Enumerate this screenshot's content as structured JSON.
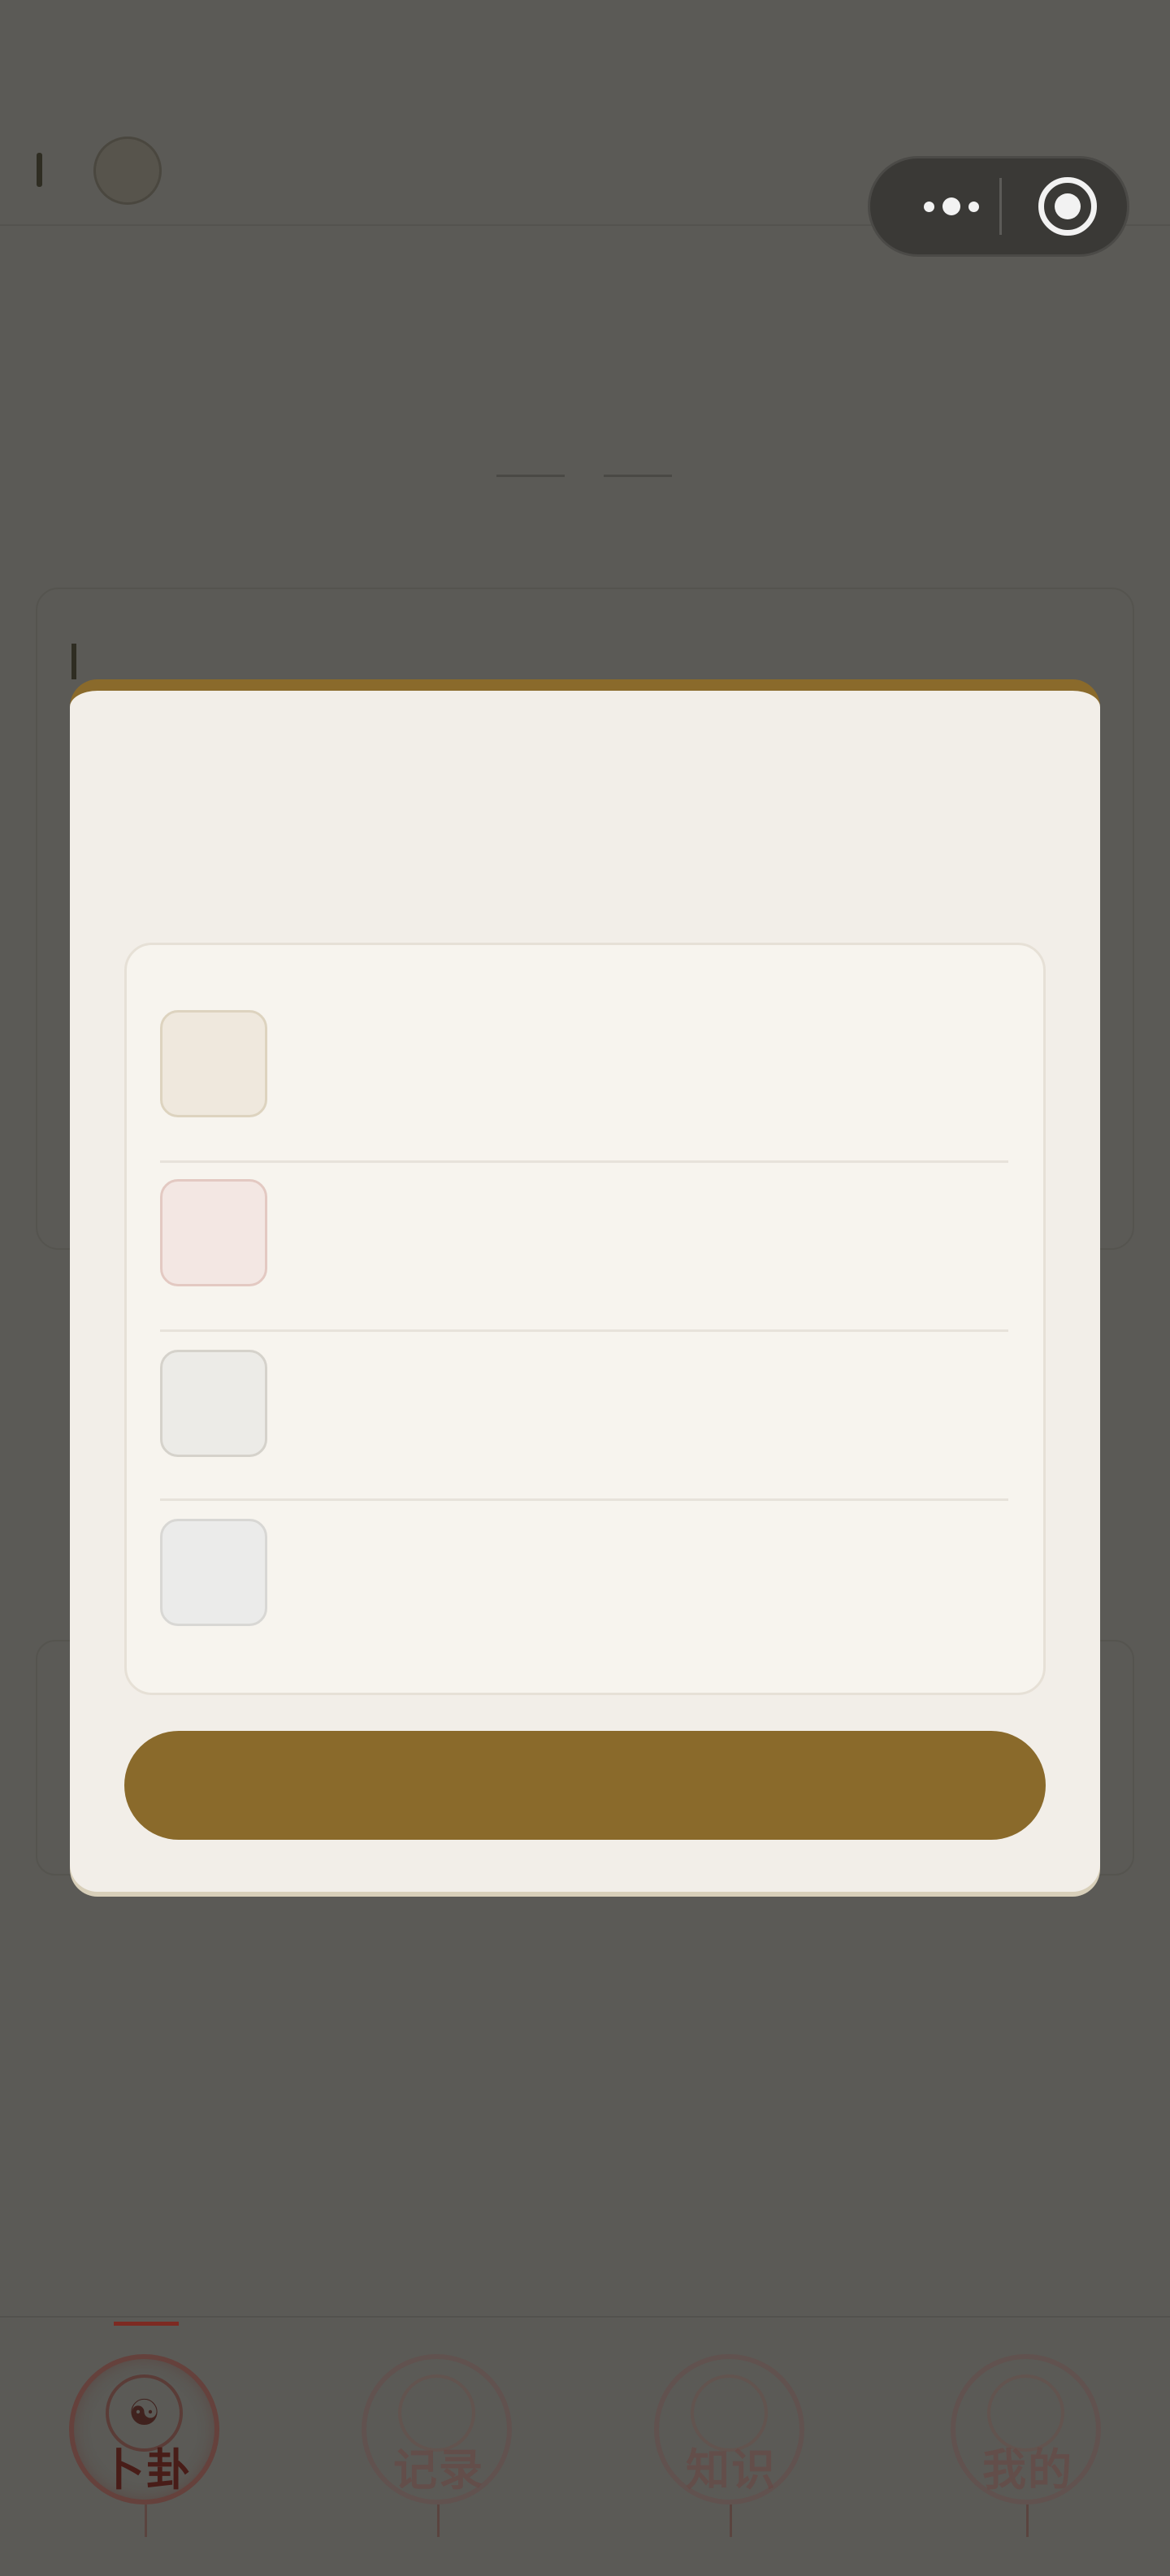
{
  "tabs": [
    {
      "label": "卜卦",
      "icon": "bagua-icon",
      "glyph": "☯",
      "active": true
    },
    {
      "label": "记录",
      "icon": "scroll-icon",
      "glyph": "",
      "active": false
    },
    {
      "label": "知识",
      "icon": "book-icon",
      "glyph": "",
      "active": false
    },
    {
      "label": "我的",
      "icon": "compass-icon",
      "glyph": "",
      "active": false
    }
  ],
  "modal": {
    "title": "",
    "options": [
      {
        "label": "",
        "swatch": "#efe8dd",
        "border": "#ddd3bf"
      },
      {
        "label": "",
        "swatch": "#f3e7e3",
        "border": "#e3c9c2"
      },
      {
        "label": "",
        "swatch": "#ecebe7",
        "border": "#d5d2cb"
      },
      {
        "label": "",
        "swatch": "#ebebea",
        "border": "#d8d7d4"
      }
    ],
    "confirm_label": ""
  },
  "colors": {
    "accent": "#8a6a2b",
    "overlay": "#5b5a56",
    "modal_bg": "#f2eee8",
    "tab_active": "#7d2a22"
  }
}
